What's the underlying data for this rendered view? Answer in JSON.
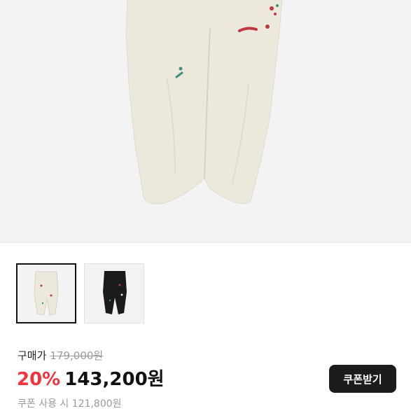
{
  "product": {
    "price_label": "구매가",
    "original_price": "179,000원",
    "discount_percent": "20%",
    "sale_price": "143,200원",
    "coupon_text": "쿠폰 사용 시 121,800원",
    "coupon_button_label": "쿠폰받기"
  },
  "gallery": {
    "selected_index": 0,
    "thumbnails": [
      {
        "variant": "cream pants",
        "color": "#ede8dc"
      },
      {
        "variant": "black pants",
        "color": "#1a1a1a"
      }
    ]
  },
  "colors": {
    "discount": "#f2333f",
    "button_bg": "#1c1c1c",
    "muted_text": "#9a9a9a"
  }
}
